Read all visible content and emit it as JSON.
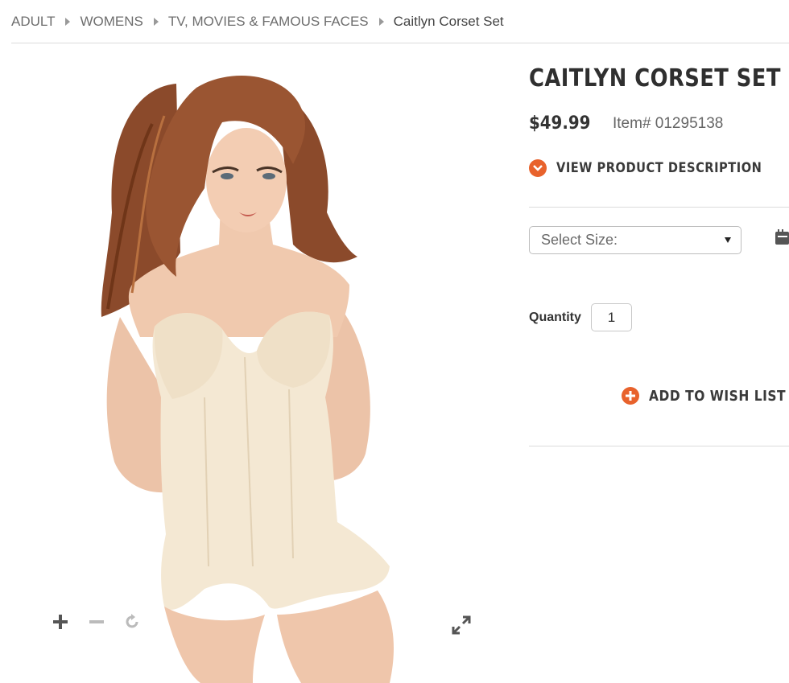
{
  "breadcrumb": {
    "items": [
      "ADULT",
      "WOMENS",
      "TV, MOVIES & FAMOUS FACES",
      "Caitlyn Corset Set"
    ]
  },
  "product": {
    "title": "CAITLYN CORSET SET",
    "price": "$49.99",
    "item_number": "Item# 01295138",
    "view_description_label": "VIEW PRODUCT DESCRIPTION",
    "size_select_value": "Select Size:",
    "quantity_label": "Quantity",
    "quantity_value": "1",
    "wish_list_label": "ADD TO WISH LIST"
  },
  "image_controls": {
    "zoom_in": "plus-icon",
    "zoom_out": "minus-icon",
    "reset": "rotate-icon",
    "fullscreen": "expand-icon"
  },
  "colors": {
    "accent": "#e8622c",
    "text": "#333333",
    "muted": "#666666",
    "divider": "#dcdcdc"
  }
}
